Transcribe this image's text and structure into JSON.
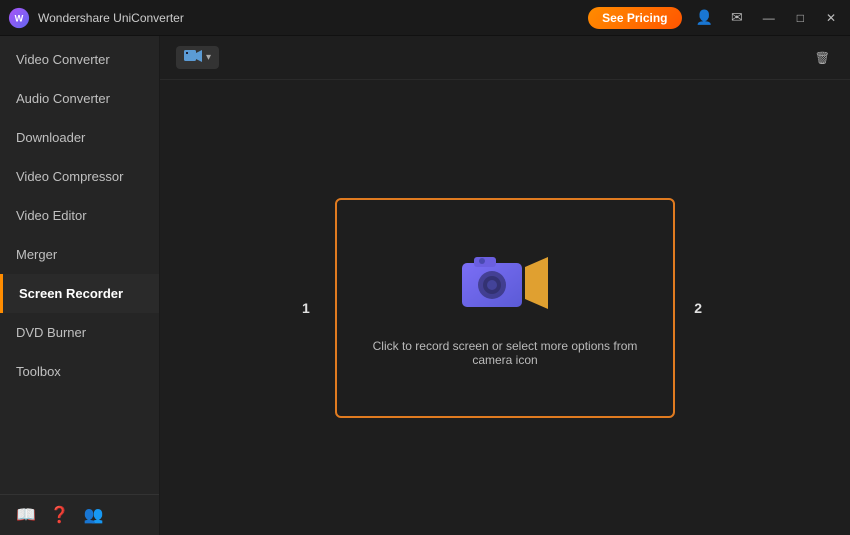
{
  "app": {
    "logo_text": "W",
    "title": "Wondershare UniConverter"
  },
  "titlebar": {
    "see_pricing_label": "See Pricing",
    "delete_all_label": "Delete All"
  },
  "sidebar": {
    "items": [
      {
        "id": "video-converter",
        "label": "Video Converter",
        "active": false
      },
      {
        "id": "audio-converter",
        "label": "Audio Converter",
        "active": false
      },
      {
        "id": "downloader",
        "label": "Downloader",
        "active": false
      },
      {
        "id": "video-compressor",
        "label": "Video Compressor",
        "active": false
      },
      {
        "id": "video-editor",
        "label": "Video Editor",
        "active": false
      },
      {
        "id": "merger",
        "label": "Merger",
        "active": false
      },
      {
        "id": "screen-recorder",
        "label": "Screen Recorder",
        "active": true
      },
      {
        "id": "dvd-burner",
        "label": "DVD Burner",
        "active": false
      },
      {
        "id": "toolbox",
        "label": "Toolbox",
        "active": false
      }
    ],
    "bottom_icons": [
      "book-icon",
      "help-icon",
      "people-icon"
    ]
  },
  "toolbar": {
    "format_icon": "▭",
    "delete_all": "Delete All"
  },
  "drop_zone": {
    "instruction_text": "Click to record screen or select more options from camera icon"
  },
  "labels": {
    "label_1": "1",
    "label_2": "2"
  }
}
